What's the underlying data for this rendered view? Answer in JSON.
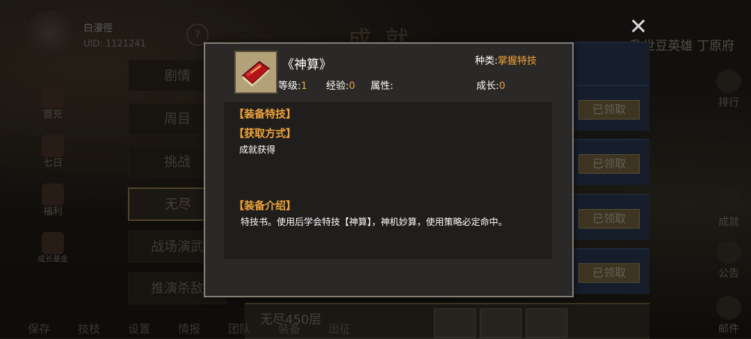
{
  "player": {
    "name": "白漫徑",
    "uid": "UID: 1121241"
  },
  "page_title": "成就",
  "top_right_title": "乱世豆英雄 丁原府",
  "help_label": "?",
  "left_menu": [
    {
      "label": "首充",
      "icon": "gift-icon"
    },
    {
      "label": "七日",
      "icon": "scroll-icon"
    },
    {
      "label": "福利",
      "icon": "coin-icon"
    },
    {
      "label": "成长基金",
      "icon": "treasure-icon"
    }
  ],
  "right_menu": [
    {
      "label": "排行",
      "icon": "ranking-icon"
    },
    {
      "label": "成就",
      "icon": "achievement-icon"
    },
    {
      "label": "公告",
      "icon": "announcement-icon"
    },
    {
      "label": "邮件",
      "icon": "mail-icon"
    }
  ],
  "tabs": [
    "剧情",
    "周目",
    "挑战",
    "无尽",
    "战场演武",
    "推演杀敌"
  ],
  "active_tab": "无尽",
  "claimed_label": "已领取",
  "bottom_row_title": "无尽450层",
  "bottom_bar": [
    "保存",
    "技枝",
    "设置",
    "情报",
    "团队",
    "装备",
    "出征"
  ],
  "modal": {
    "item_icon": "red-book-icon",
    "item_name": "《神算》",
    "kind_label": "种类:",
    "kind_value": "掌握特技",
    "level_label": "等级:",
    "level_value": "1",
    "exp_label": "经验:",
    "exp_value": "0",
    "attr_label": "属性:",
    "attr_value": "",
    "growth_label": "成长:",
    "growth_value": "0",
    "equip_skill_header": "【装备特技】",
    "obtain_header": "【获取方式】",
    "obtain_text": "成就获得",
    "intro_header": "【装备介绍】",
    "intro_text": "特技书。使用后学会特技【神算】，神机妙算，使用策略必定命中。"
  },
  "colors": {
    "accent": "#f0a33a",
    "modal_bg": "#2b2927",
    "detail_bg": "#1f1e1c"
  }
}
